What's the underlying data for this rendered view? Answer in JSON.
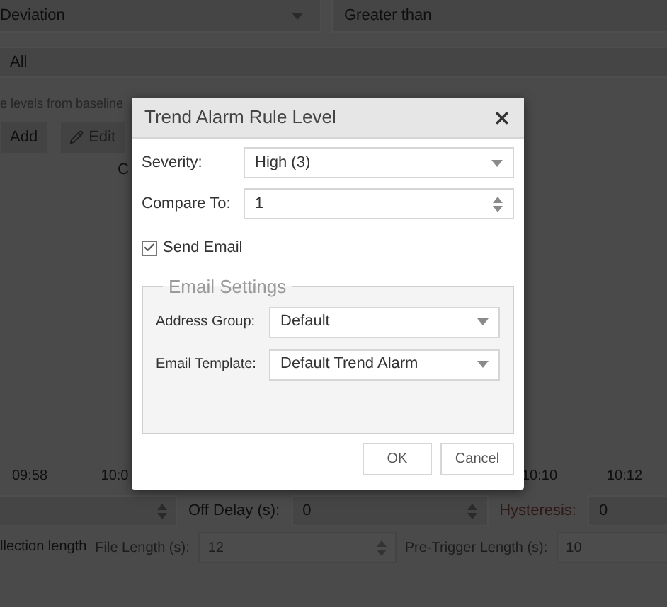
{
  "background": {
    "metric_select": {
      "value": "Deviation"
    },
    "operator_field": {
      "value": "Greater than"
    },
    "scope_field": {
      "value": "All"
    },
    "hint": "e levels from baseline",
    "toolbar": [
      {
        "kind": "add",
        "label": "Add"
      },
      {
        "kind": "edit",
        "label": "Edit"
      }
    ],
    "table": {
      "columns": [
        "C"
      ]
    },
    "time_axis": [
      "09:58",
      "10:0",
      "10:10",
      "10:12"
    ],
    "delay_row": {
      "off_delay_label": "Off Delay (s):",
      "off_delay": "0",
      "hysteresis_label": "Hysteresis:",
      "hysteresis": "0"
    },
    "collection_row": {
      "label": "llection length",
      "file_length_label": "File Length (s):",
      "file_length": "12",
      "pre_trigger_label": "Pre-Trigger Length (s):",
      "pre_trigger": "10",
      "disabled": true
    }
  },
  "dialog": {
    "title": "Trend Alarm Rule Level",
    "severity": {
      "label": "Severity:",
      "value": "High (3)"
    },
    "compare_to": {
      "label": "Compare To:",
      "value": "1"
    },
    "send_email": {
      "label": "Send Email",
      "checked": true
    },
    "email_settings": {
      "legend": "Email Settings",
      "address_group": {
        "label": "Address Group:",
        "value": "Default"
      },
      "email_template": {
        "label": "Email Template:",
        "value": "Default Trend Alarm"
      }
    },
    "buttons": [
      "OK",
      "Cancel"
    ]
  }
}
